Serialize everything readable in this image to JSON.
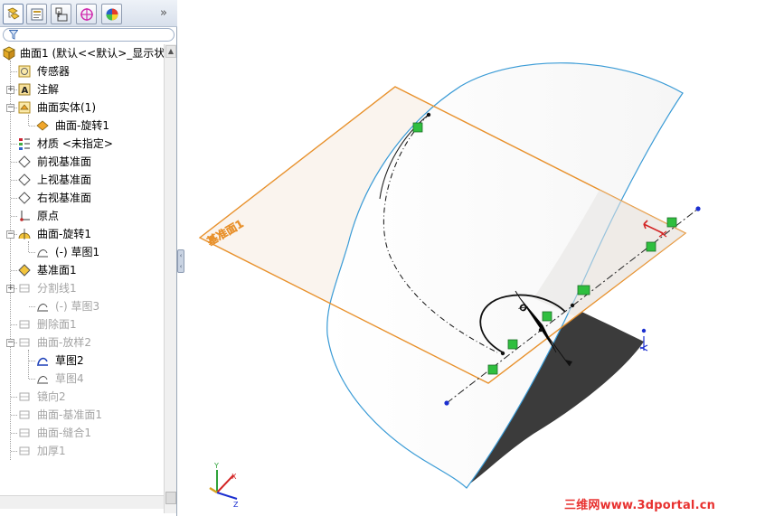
{
  "toolbar": {
    "tabs": [
      "feature-manager-tab",
      "property-manager-tab",
      "configuration-manager-tab",
      "dimxpert-manager-tab",
      "display-manager-tab"
    ],
    "expand_label": "»"
  },
  "tree": {
    "root_label": "曲面1  (默认<<默认>_显示状",
    "items": [
      {
        "label": "传感器",
        "icon": "sensor-icon",
        "state": "normal"
      },
      {
        "label": "注解",
        "icon": "annotation-icon",
        "state": "normal"
      },
      {
        "label": "曲面实体(1)",
        "icon": "surface-bodies-icon",
        "state": "normal"
      },
      {
        "label": "曲面-旋转1",
        "icon": "surface-body-icon",
        "state": "normal"
      },
      {
        "label": "材质 <未指定>",
        "icon": "material-icon",
        "state": "normal"
      },
      {
        "label": "前视基准面",
        "icon": "plane-icon",
        "state": "normal"
      },
      {
        "label": "上视基准面",
        "icon": "plane-icon",
        "state": "normal"
      },
      {
        "label": "右视基准面",
        "icon": "plane-icon",
        "state": "normal"
      },
      {
        "label": "原点",
        "icon": "origin-icon",
        "state": "normal"
      },
      {
        "label": "曲面-旋转1",
        "icon": "revolve-icon",
        "state": "normal"
      },
      {
        "label": "(-) 草图1",
        "icon": "sketch-icon",
        "state": "normal"
      },
      {
        "label": "基准面1",
        "icon": "plane-icon",
        "state": "normal"
      },
      {
        "label": "分割线1",
        "icon": "split-line-icon",
        "state": "suppressed"
      },
      {
        "label": "(-) 草图3",
        "icon": "sketch-icon",
        "state": "suppressed"
      },
      {
        "label": "删除面1",
        "icon": "delete-face-icon",
        "state": "suppressed"
      },
      {
        "label": "曲面-放样2",
        "icon": "loft-icon",
        "state": "suppressed"
      },
      {
        "label": "草图2",
        "icon": "sketch-icon",
        "state": "editing"
      },
      {
        "label": "草图4",
        "icon": "sketch-icon",
        "state": "suppressed"
      },
      {
        "label": "镜向2",
        "icon": "mirror-icon",
        "state": "suppressed"
      },
      {
        "label": "曲面-基准面1",
        "icon": "planar-surface-icon",
        "state": "suppressed"
      },
      {
        "label": "曲面-缝合1",
        "icon": "knit-icon",
        "state": "suppressed"
      },
      {
        "label": "加厚1",
        "icon": "thicken-icon",
        "state": "suppressed"
      }
    ]
  },
  "viewport": {
    "plane_label": "基准面1",
    "dimension_label": "Ø",
    "triad_labels": {
      "x": "X",
      "y": "Y",
      "z": "Z"
    }
  },
  "watermark": "三维网www.3dportal.cn",
  "colors": {
    "plane_edge": "#e8912c",
    "surface_edge": "#3a9bd6",
    "relation_green": "#2fbf3f",
    "shadow": "#2a2a2a",
    "watermark": "#e8312f"
  }
}
